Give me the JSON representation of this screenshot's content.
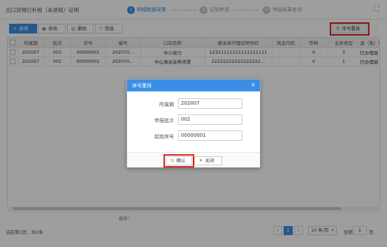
{
  "app_title": "出口货物已补税（未退税）证明",
  "steps": [
    {
      "num": "1",
      "label": "明细数据采集"
    },
    {
      "num": "2",
      "label": "证明申请"
    },
    {
      "num": "3",
      "label": "申报结果查询"
    }
  ],
  "icons": {
    "fullscreen": "⛶",
    "new": "+",
    "edit": "▣",
    "delete": "▥",
    "filter": "▽",
    "reorder": "⇅",
    "bell": "♢",
    "close": "×",
    "confirm": "⊙",
    "cancel": "✕"
  },
  "toolbar": {
    "new_label": "新增",
    "edit_label": "修改",
    "delete_label": "删除",
    "filter_label": "筛选",
    "reorder_label": "序号重排"
  },
  "table": {
    "columns": [
      "所属期",
      "批次",
      "序号",
      "编号",
      "口岸名称",
      "报关单代理证明号码",
      "商品代码",
      "币种",
      "业务类型",
      "退（免）税"
    ],
    "rows": [
      [
        "202007",
        "002",
        "00000001",
        "202070...",
        "中小视力",
        "12311111111111111111",
        "",
        "V",
        "3",
        "已办理退（免"
      ],
      [
        "202007",
        "002",
        "00000002",
        "202070...",
        "中山海关驻神湾港",
        "22222222222222222...",
        "",
        "V",
        "1",
        "已办理退（免"
      ]
    ]
  },
  "footer": {
    "sum_label": "合计："
  },
  "pager": {
    "info": "当前第1页，共2条",
    "prev": "‹",
    "current": "1",
    "next": "›",
    "page_size": "10 条/页",
    "page_size_arrow": "▾",
    "goto_label": "到第",
    "goto_value": "1",
    "goto_suffix": "页"
  },
  "dialog": {
    "title": "序号重排",
    "fields": [
      {
        "label": "所属期",
        "value": "202007"
      },
      {
        "label": "申报批次",
        "value": "002"
      },
      {
        "label": "起始序号",
        "value": "00000001"
      }
    ],
    "confirm_label": "确认",
    "cancel_label": "关闭"
  },
  "colors": {
    "primary": "#3a8ee6",
    "highlight": "#d7261e"
  }
}
